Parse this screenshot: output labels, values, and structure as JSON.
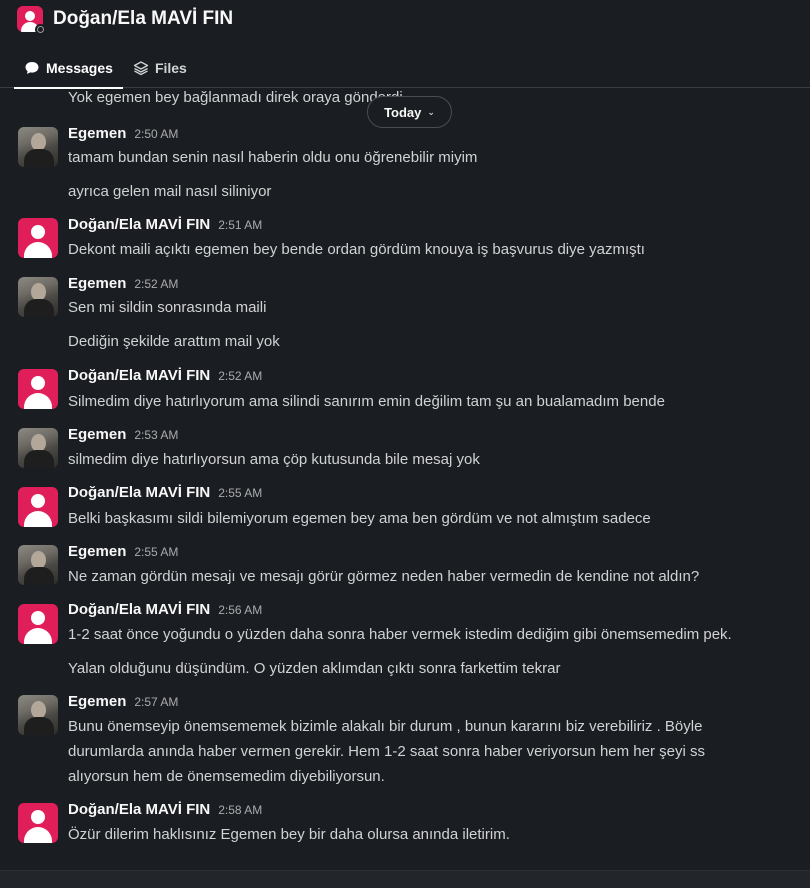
{
  "channel": {
    "title": "Doğan/Ela MAVİ FIN"
  },
  "tabs": [
    {
      "label": "Messages",
      "icon": "message-bubble-icon",
      "active": true
    },
    {
      "label": "Files",
      "icon": "layers-icon",
      "active": false
    }
  ],
  "date_divider": {
    "label": "Today",
    "icon": "chevron-down-icon"
  },
  "partial_message": "Yok egemen bey bağlanmadı direk oraya gönderdi",
  "messages": [
    {
      "sender": "Egemen",
      "time": "2:50 AM",
      "avatar": "photo",
      "lines": [
        "tamam bundan senin nasıl haberin oldu onu öğrenebilir miyim"
      ]
    },
    {
      "sender": "",
      "time": "",
      "avatar": "",
      "lines": [
        "ayrıca gelen mail nasıl siliniyor"
      ]
    },
    {
      "sender": "Doğan/Ela MAVİ FIN",
      "time": "2:51 AM",
      "avatar": "pink",
      "lines": [
        "Dekont maili açıktı egemen bey bende ordan gördüm knouya iş başvurus diye yazmıştı"
      ]
    },
    {
      "sender": "Egemen",
      "time": "2:52 AM",
      "avatar": "photo",
      "lines": [
        "Sen mi sildin sonrasında maili"
      ]
    },
    {
      "sender": "",
      "time": "",
      "avatar": "",
      "lines": [
        "Dediğin şekilde arattım mail yok"
      ]
    },
    {
      "sender": "Doğan/Ela MAVİ FIN",
      "time": "2:52 AM",
      "avatar": "pink",
      "lines": [
        "Silmedim diye hatırlıyorum ama silindi sanırım emin değilim tam şu an bualamadım bende"
      ]
    },
    {
      "sender": "Egemen",
      "time": "2:53 AM",
      "avatar": "photo",
      "lines": [
        "silmedim diye hatırlıyorsun ama çöp kutusunda bile mesaj yok"
      ]
    },
    {
      "sender": "Doğan/Ela MAVİ FIN",
      "time": "2:55 AM",
      "avatar": "pink",
      "lines": [
        "Belki başkasımı sildi bilemiyorum egemen bey ama ben gördüm ve not almıştım sadece"
      ]
    },
    {
      "sender": "Egemen",
      "time": "2:55 AM",
      "avatar": "photo",
      "lines": [
        "Ne zaman gördün mesajı ve mesajı görür görmez neden haber vermedin de kendine not aldın?"
      ]
    },
    {
      "sender": "Doğan/Ela MAVİ FIN",
      "time": "2:56 AM",
      "avatar": "pink",
      "lines": [
        "1-2 saat önce yoğundu o yüzden daha sonra haber vermek istedim dediğim gibi önemsemedim pek."
      ]
    },
    {
      "sender": "",
      "time": "",
      "avatar": "",
      "lines": [
        "Yalan olduğunu düşündüm. O yüzden aklımdan çıktı sonra farkettim tekrar"
      ]
    },
    {
      "sender": "Egemen",
      "time": "2:57 AM",
      "avatar": "photo",
      "lines": [
        "Bunu önemseyip önemsememek bizimle alakalı bir durum , bunun kararını biz verebiliriz . Böyle",
        "durumlarda anında haber vermen gerekir. Hem 1-2 saat sonra haber veriyorsun hem  her şeyi ss",
        "alıyorsun hem de önemsemedim diyebiliyorsun."
      ]
    },
    {
      "sender": "Doğan/Ela MAVİ FIN",
      "time": "2:58 AM",
      "avatar": "pink",
      "lines": [
        "Özür dilerim haklısınız Egemen bey bir daha olursa anında iletirim."
      ]
    }
  ]
}
